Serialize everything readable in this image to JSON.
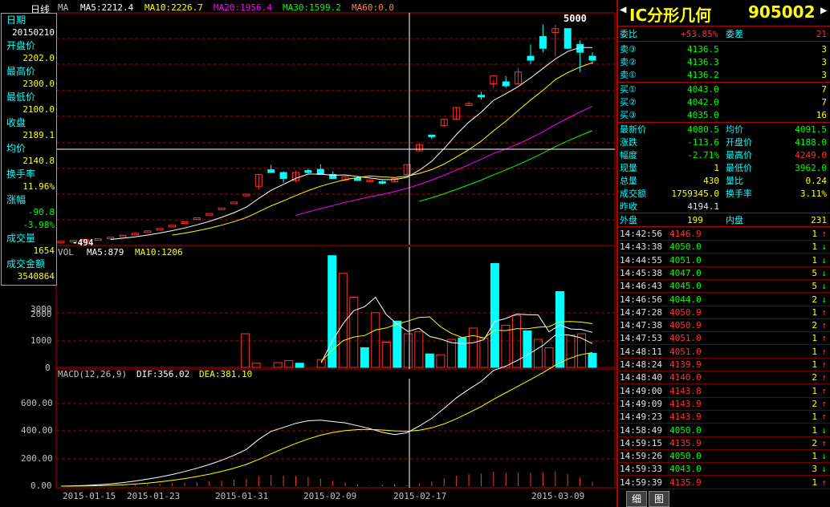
{
  "period": "日线",
  "ma_legend": {
    "label": "MA",
    "ma5": "MA5:2212.4",
    "ma10": "MA10:2226.7",
    "ma20": "MA20:1956.4",
    "ma30": "MA30:1599.2",
    "ma60": "MA60:0.0"
  },
  "peak_label": "5000",
  "low_label": "-494",
  "vol_legend": {
    "label": "VOL",
    "ma5": "MA5:879",
    "ma10": "MA10:1206"
  },
  "macd_legend": {
    "label": "MACD(12,26,9)",
    "dif": "DIF:356.02",
    "dea": "DEA:381.10"
  },
  "vol_axis": [
    "3000",
    "2000",
    "1000",
    "0"
  ],
  "macd_axis": [
    "600.00",
    "400.00",
    "200.00",
    "0.00"
  ],
  "date_axis": [
    "2015-01-15",
    "2015-01-23",
    "2015-01-31",
    "2015-02-09",
    "2015-02-17",
    "2015-03-09"
  ],
  "info": [
    {
      "label": "日期",
      "value": "20150210",
      "color": "#ffffff"
    },
    {
      "label": "开盘价",
      "value": "2202.0",
      "color": "#ffff00"
    },
    {
      "label": "最高价",
      "value": "2300.0",
      "color": "#ffff00"
    },
    {
      "label": "最低价",
      "value": "2100.0",
      "color": "#ffff00"
    },
    {
      "label": "收盘",
      "value": "2189.1",
      "color": "#ffff00"
    },
    {
      "label": "均价",
      "value": "2140.8",
      "color": "#ffff00"
    },
    {
      "label": "换手率",
      "value": "11.96%",
      "color": "#ffff00"
    },
    {
      "label": "涨幅",
      "value": "-90.8",
      "value2": "-3.98%",
      "color": "#00ff00"
    },
    {
      "label": "成交量",
      "value": "1654",
      "color": "#ffff00"
    },
    {
      "label": "成交金额",
      "value": "3540864",
      "color": "#ffff00"
    }
  ],
  "title": {
    "name": "IC分形几何",
    "code": "905002"
  },
  "weibi": {
    "label": "委比",
    "value": "+53.85%",
    "label2": "委差",
    "value2": "21"
  },
  "asks": [
    {
      "label": "卖③",
      "price": "4136.5",
      "qty": "3"
    },
    {
      "label": "卖②",
      "price": "4136.3",
      "qty": "3"
    },
    {
      "label": "卖①",
      "price": "4136.2",
      "qty": "3"
    }
  ],
  "bids": [
    {
      "label": "买①",
      "price": "4043.0",
      "qty": "7"
    },
    {
      "label": "买②",
      "price": "4042.0",
      "qty": "7"
    },
    {
      "label": "买③",
      "price": "4035.0",
      "qty": "16"
    }
  ],
  "quote": [
    {
      "l1": "最新价",
      "v1": "4080.5",
      "c1": "#00ff00",
      "l2": "均价",
      "v2": "4091.5",
      "c2": "#00ff00"
    },
    {
      "l1": "涨跌",
      "v1": "-113.6",
      "c1": "#00ff00",
      "l2": "开盘价",
      "v2": "4188.0",
      "c2": "#00ff00"
    },
    {
      "l1": "幅度",
      "v1": "-2.71%",
      "c1": "#00ff00",
      "l2": "最高价",
      "v2": "4249.0",
      "c2": "#ff3030"
    },
    {
      "l1": "现量",
      "v1": "1",
      "c1": "#ffff00",
      "l2": "最低价",
      "v2": "3962.0",
      "c2": "#00ff00"
    },
    {
      "l1": "总量",
      "v1": "430",
      "c1": "#ffff00",
      "l2": "量比",
      "v2": "0.24",
      "c2": "#ffff00"
    },
    {
      "l1": "成交额",
      "v1": "1759345.0",
      "c1": "#ffff00",
      "l2": "换手率",
      "v2": "3.11%",
      "c2": "#ffff00"
    },
    {
      "l1": "昨收",
      "v1": "4194.1",
      "c1": "#e0e0e0",
      "l2": "",
      "v2": "",
      "c2": "#e0e0e0"
    }
  ],
  "outer": {
    "label": "外盘",
    "value": "199",
    "label2": "内盘",
    "value2": "231"
  },
  "trades": [
    {
      "time": "14:42:56",
      "price": "4146.9",
      "qty": "1",
      "dir": "↑",
      "color": "#ff3030"
    },
    {
      "time": "14:43:38",
      "price": "4050.0",
      "qty": "1",
      "dir": "↓",
      "color": "#00ff00"
    },
    {
      "time": "14:44:55",
      "price": "4051.0",
      "qty": "1",
      "dir": "↓",
      "color": "#00ff00"
    },
    {
      "time": "14:45:38",
      "price": "4047.0",
      "qty": "5",
      "dir": "↓",
      "color": "#00ff00"
    },
    {
      "time": "14:46:43",
      "price": "4045.0",
      "qty": "5",
      "dir": "↓",
      "color": "#00ff00"
    },
    {
      "time": "14:46:56",
      "price": "4044.0",
      "qty": "2",
      "dir": "↓",
      "color": "#00ff00"
    },
    {
      "time": "14:47:28",
      "price": "4050.9",
      "qty": "1",
      "dir": "↑",
      "color": "#ff3030"
    },
    {
      "time": "14:47:38",
      "price": "4050.9",
      "qty": "2",
      "dir": "↑",
      "color": "#ff3030"
    },
    {
      "time": "14:47:53",
      "price": "4051.0",
      "qty": "1",
      "dir": "↑",
      "color": "#ff3030"
    },
    {
      "time": "14:48:11",
      "price": "4051.0",
      "qty": "1",
      "dir": "↑",
      "color": "#ff3030"
    },
    {
      "time": "14:48:24",
      "price": "4139.9",
      "qty": "1",
      "dir": "↑",
      "color": "#ff3030"
    },
    {
      "time": "14:48:40",
      "price": "4140.0",
      "qty": "2",
      "dir": "↑",
      "color": "#ff3030"
    },
    {
      "time": "14:49:00",
      "price": "4143.8",
      "qty": "1",
      "dir": "↑",
      "color": "#ff3030"
    },
    {
      "time": "14:49:09",
      "price": "4143.9",
      "qty": "2",
      "dir": "↑",
      "color": "#ff3030"
    },
    {
      "time": "14:49:23",
      "price": "4143.9",
      "qty": "1",
      "dir": "↑",
      "color": "#ff3030"
    },
    {
      "time": "14:58:49",
      "price": "4050.0",
      "qty": "1",
      "dir": "↓",
      "color": "#00ff00"
    },
    {
      "time": "14:59:15",
      "price": "4135.9",
      "qty": "2",
      "dir": "↑",
      "color": "#ff3030"
    },
    {
      "time": "14:59:26",
      "price": "4050.0",
      "qty": "1",
      "dir": "↓",
      "color": "#00ff00"
    },
    {
      "time": "14:59:33",
      "price": "4043.0",
      "qty": "3",
      "dir": "↓",
      "color": "#00ff00"
    },
    {
      "time": "14:59:39",
      "price": "4135.9",
      "qty": "1",
      "dir": "↑",
      "color": "#ff3030"
    }
  ],
  "tabs": [
    "细",
    "图"
  ],
  "colors": {
    "up": "#ff3030",
    "down": "#00ffff",
    "grid": "#b00000",
    "ma5": "#ffffff",
    "ma10": "#ffff00",
    "ma20": "#ff00ff",
    "ma30": "#00ff00"
  },
  "chart_data": {
    "type": "candlestick",
    "ohlc": [
      [
        -494,
        -494,
        -494,
        -494
      ],
      [
        -480,
        -470,
        -480,
        -470
      ],
      [
        -460,
        -450,
        -460,
        -450
      ],
      [
        -440,
        -430,
        -440,
        -430
      ],
      [
        -400,
        -390,
        -400,
        -390
      ],
      [
        -350,
        -340,
        -350,
        -340
      ],
      [
        -300,
        -290,
        -300,
        -290
      ],
      [
        -240,
        -230,
        -240,
        -230
      ],
      [
        -180,
        -170,
        -180,
        -170
      ],
      [
        -100,
        -90,
        -100,
        -90
      ],
      [
        -10,
        0,
        -10,
        0
      ],
      [
        90,
        100,
        90,
        100
      ],
      [
        200,
        210,
        200,
        210
      ],
      [
        340,
        350,
        340,
        350
      ],
      [
        490,
        500,
        490,
        500
      ],
      [
        680,
        700,
        680,
        700
      ],
      [
        900,
        1200,
        820,
        1200
      ],
      [
        1320,
        1450,
        1250,
        1250
      ],
      [
        1250,
        1280,
        1000,
        1100
      ],
      [
        1050,
        1300,
        1000,
        1250
      ],
      [
        1300,
        1350,
        1200,
        1250
      ],
      [
        1330,
        1460,
        1200,
        1200
      ],
      [
        1200,
        1280,
        1100,
        1100
      ],
      [
        1050,
        1160,
        1050,
        1150
      ],
      [
        1110,
        1150,
        1050,
        1050
      ],
      [
        1050,
        1060,
        1000,
        1060
      ],
      [
        1020,
        1050,
        950,
        990
      ],
      [
        1020,
        1100,
        1020,
        1100
      ],
      [
        1200,
        1450,
        1200,
        1450
      ],
      [
        1800,
        2000,
        1800,
        1950
      ],
      [
        2200,
        2200,
        2100,
        2190
      ],
      [
        2440,
        2600,
        2400,
        2600
      ],
      [
        2600,
        2900,
        2600,
        2900
      ],
      [
        2950,
        3050,
        2950,
        3000
      ],
      [
        3210,
        3300,
        3100,
        3200
      ],
      [
        3500,
        3600,
        3400,
        3700
      ],
      [
        3550,
        3700,
        3400,
        3450
      ],
      [
        3500,
        3900,
        3500,
        3800
      ],
      [
        4200,
        4500,
        4000,
        4100
      ],
      [
        4700,
        5000,
        4300,
        4400
      ],
      [
        4800,
        5000,
        4200,
        4900
      ],
      [
        4900,
        4900,
        4400,
        4400
      ],
      [
        4500,
        4600,
        3800,
        4300
      ],
      [
        4200,
        4300,
        4000,
        4100
      ]
    ],
    "volume": [
      0,
      0,
      0,
      0,
      0,
      0,
      0,
      0,
      0,
      0,
      0,
      0,
      0,
      0,
      0,
      0,
      0,
      1200,
      150,
      0,
      170,
      240,
      150,
      0,
      280,
      3980,
      3350,
      2500,
      700,
      1950,
      900,
      1650,
      1200,
      1280,
      480,
      450,
      1000,
      1050,
      1400,
      1050,
      3700,
      1500,
      1850,
      1300,
      1000,
      700,
      2700,
      1150,
      1200,
      500
    ],
    "ylim": [
      -600,
      5300
    ],
    "dif_end": 356.02,
    "dea_end": 381.1
  }
}
